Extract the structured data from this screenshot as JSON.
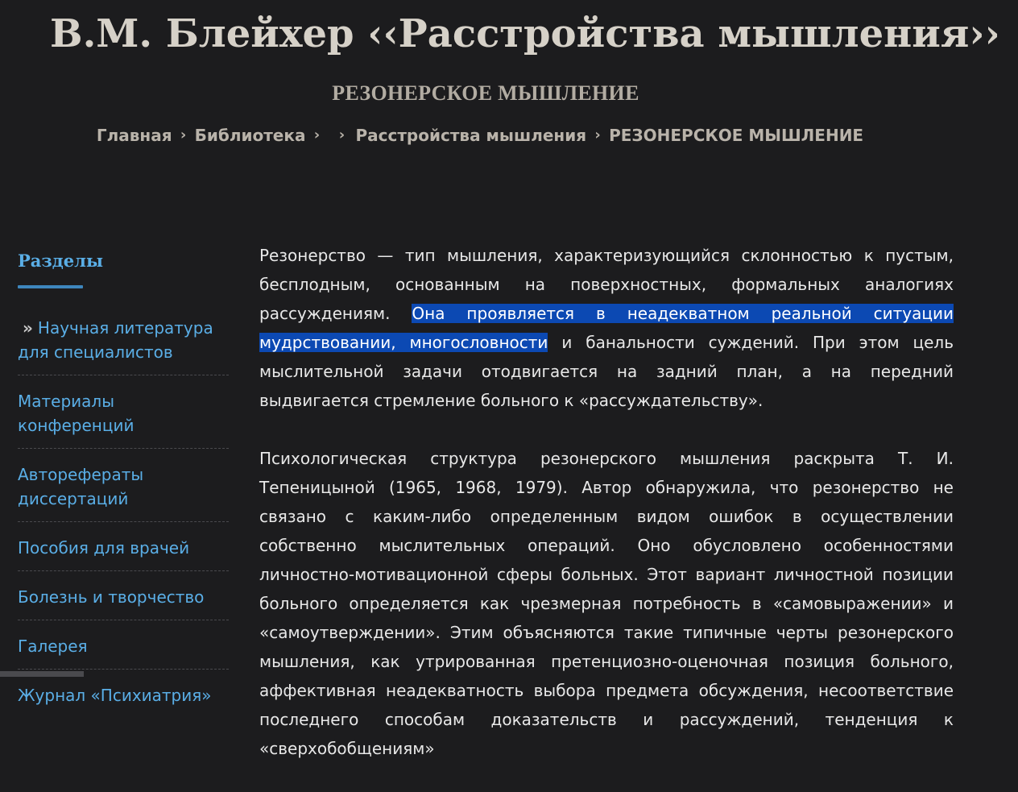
{
  "header": {
    "site_title": "В.М. Блейхер ‹‹Расстройства мышления››",
    "page_heading": "РЕЗОНЕРСКОЕ МЫШЛЕНИЕ"
  },
  "breadcrumb": {
    "home": "Главная",
    "library": "Библиотека",
    "book": "Расстройства мышления",
    "current": "РЕЗОНЕРСКОЕ МЫШЛЕНИЕ",
    "separator": "›"
  },
  "sidebar": {
    "title": "Разделы",
    "items": [
      {
        "label": "Научная литература для специалистов",
        "prefix": "»"
      },
      {
        "label": "Материалы конференций"
      },
      {
        "label": "Авторефераты диссертаций"
      },
      {
        "label": "Пособия для врачей"
      },
      {
        "label": "Болезнь и творчество"
      },
      {
        "label": "Галерея"
      },
      {
        "label": "Журнал «Психиатрия»"
      }
    ]
  },
  "article": {
    "p1_a": "Резонерство — тип мышления, характеризующийся склонностью к пустым, бесплодным, основанным на поверхностных, формальных аналогиях рассуждениям. ",
    "p1_selected": "Она проявляется в неадекватном реальной ситуации мудрствовании, многословности",
    "p1_b": " и банальности суждений. При этом цель мыслительной задачи отодвигается на задний план, а на передний выдвигается стремление больного к «рассуждательству».",
    "p2": "Психологическая структура резонерского мышления раскрыта Т. И. Тепеницыной (1965, 1968, 1979). Автор обнаружила, что резонерство не связано с каким-либо определенным видом ошибок в осуществлении собственно мыслительных операций. Оно обусловлено особенностями личностно-мотивационной сферы больных. Этот вариант личностной позиции больного определяется как чрезмерная потребность в «самовыражении» и «самоутверждении». Этим объясняются такие типичные черты резонерского мышления, как утрированная претенциозно-оценочная позиция больного, аффективная неадекватность выбора предмета обсуждения, несоответствие последнего способам доказательств и рассуждений, тенденция к «сверхобобщениям»"
  },
  "colors": {
    "background": "#1c1c1e",
    "link": "#5aaee6",
    "selection": "#0c49b3"
  }
}
